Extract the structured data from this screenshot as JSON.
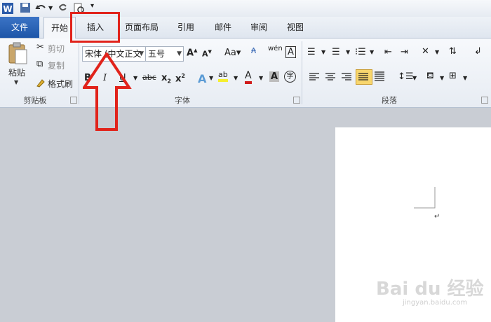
{
  "tabs": {
    "file": "文件",
    "home": "开始",
    "insert": "插入",
    "layout": "页面布局",
    "references": "引用",
    "mailings": "邮件",
    "review": "审阅",
    "view": "视图"
  },
  "clipboard": {
    "paste": "粘贴",
    "cut": "剪切",
    "copy": "复制",
    "format_painter": "格式刷",
    "group_label": "剪贴板"
  },
  "font": {
    "font_name": "宋体 (中文正文",
    "font_size": "五号",
    "group_label": "字体"
  },
  "paragraph": {
    "group_label": "段落"
  },
  "colors": {
    "accent": "#1e56a8",
    "annotation": "#e1231b",
    "highlight": "#f8e27a"
  },
  "watermark": {
    "text": "Bai du 经验",
    "url": "jingyan.baidu.com"
  },
  "icons": [
    "word-logo-icon",
    "save-icon",
    "undo-icon",
    "redo-icon",
    "print-preview-icon",
    "customize-qat-icon",
    "paste-icon",
    "cut-icon",
    "copy-icon",
    "format-painter-icon",
    "grow-font-icon",
    "shrink-font-icon",
    "change-case-icon",
    "clear-format-icon",
    "phonetic-guide-icon",
    "character-border-icon",
    "bold-icon",
    "italic-icon",
    "underline-icon",
    "strikethrough-icon",
    "subscript-icon",
    "superscript-icon",
    "text-effects-icon",
    "highlight-icon",
    "font-color-icon",
    "character-shading-icon",
    "enclose-characters-icon",
    "bullets-icon",
    "numbering-icon",
    "multilevel-list-icon",
    "decrease-indent-icon",
    "increase-indent-icon",
    "chinese-layout-icon",
    "sort-icon",
    "show-marks-icon",
    "align-left-icon",
    "center-icon",
    "align-right-icon",
    "justify-icon",
    "distributed-icon",
    "line-spacing-icon",
    "shading-icon",
    "borders-icon",
    "dialog-launcher-icon",
    "red-up-arrow-icon",
    "paragraph-mark-icon"
  ]
}
